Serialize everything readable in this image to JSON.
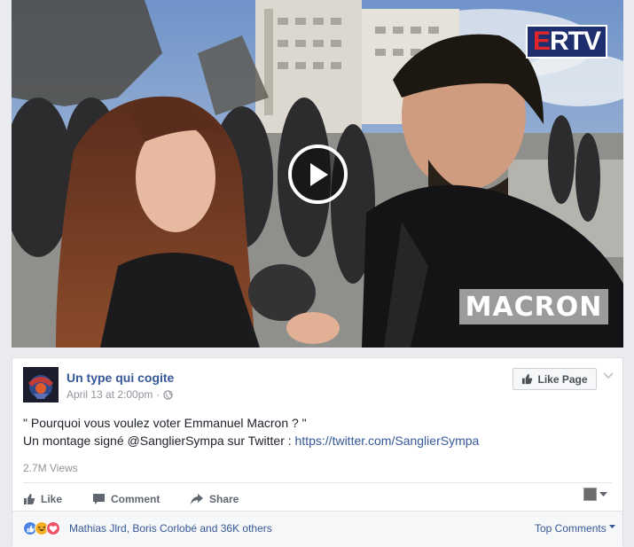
{
  "video": {
    "watermark_left": "E",
    "watermark_right": "RTV",
    "caption_badge": "MACRON"
  },
  "post": {
    "page_name": "Un type qui cogite",
    "timestamp": "April 13 at 2:00pm",
    "separator": "·",
    "like_page_label": "Like Page",
    "text_line1": "\" Pourquoi vous voulez voter Emmanuel Macron ? \"",
    "text_line2_prefix": "Un montage signé @SanglierSympa sur Twitter : ",
    "text_link": "https://twitter.com/SanglierSympa",
    "views": "2.7M Views"
  },
  "actions": {
    "like": "Like",
    "comment": "Comment",
    "share": "Share"
  },
  "reactions": {
    "summary": "Mathias Jlrd, Boris Corlobé and 36K others",
    "top_comments": "Top Comments"
  },
  "colors": {
    "link": "#365899",
    "muted": "#90949c",
    "like_blue": "#4e86e4",
    "haha_yellow": "#f7b125",
    "love_red": "#f25268"
  }
}
